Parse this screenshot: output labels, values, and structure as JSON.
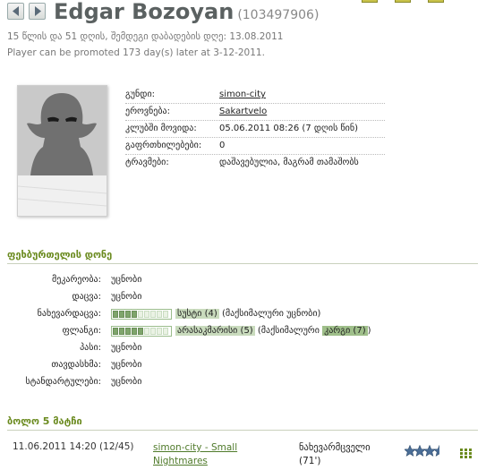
{
  "player": {
    "name": "Edgar Bozoyan",
    "id": "(103497906)",
    "age_line": "15 წლის და 51 დღის, შემდეგი დაბადების დღე: 13.08.2011",
    "promo_line": "Player can be promoted 173 day(s) later at 3-12-2011."
  },
  "info": {
    "team_label": "გუნდი:",
    "team_value": "simon-city",
    "nationality_label": "ეროვნება:",
    "nationality_value": "Sakartvelo",
    "joined_label": "კლუბში მოვიდა:",
    "joined_value": "05.06.2011 08:26 (7 დღის წინ)",
    "warnings_label": "გაფრთხილებები:",
    "warnings_value": "0",
    "injuries_label": "ტრავმები:",
    "injuries_value": "დაშავებულია, მაგრამ თამაშობს"
  },
  "skills_section": {
    "title": "ფეხბურთელის დონე",
    "goalkeeping_label": "მეკარეობა:",
    "goalkeeping_value": "უცნობი",
    "defending_label": "დაცვა:",
    "defending_value": "უცნობი",
    "playmaking_label": "ნახევარდაცვა:",
    "playmaking_level": "სუსტი (4)",
    "playmaking_max": "(მაქსიმალური უცნობი)",
    "playmaking_filled": 4,
    "winger_label": "ფლანგი:",
    "winger_level": "არასაკმარისი (5)",
    "winger_max_prefix": "(მაქსიმალური",
    "winger_max_level": "კარგი (7)",
    "winger_max_suffix": ")",
    "winger_filled": 5,
    "passing_label": "პასი:",
    "passing_value": "უცნობი",
    "scoring_label": "თავდასხმა:",
    "scoring_value": "უცნობი",
    "setpieces_label": "სტანდარტულები:",
    "setpieces_value": "უცნობი",
    "bar_segments": 9
  },
  "matches_section": {
    "title": "ბოლო 5 მატჩი",
    "rows": [
      {
        "date": "11.06.2011 14:20 (12/45)",
        "match": "simon-city - Small Nightmares",
        "position": "ნახევარმცველი (71')",
        "stars": 3.5
      }
    ]
  },
  "colors": {
    "accent": "#6a8a1e",
    "link": "#4f7a2a",
    "bar_fill": "#7fa56c"
  }
}
